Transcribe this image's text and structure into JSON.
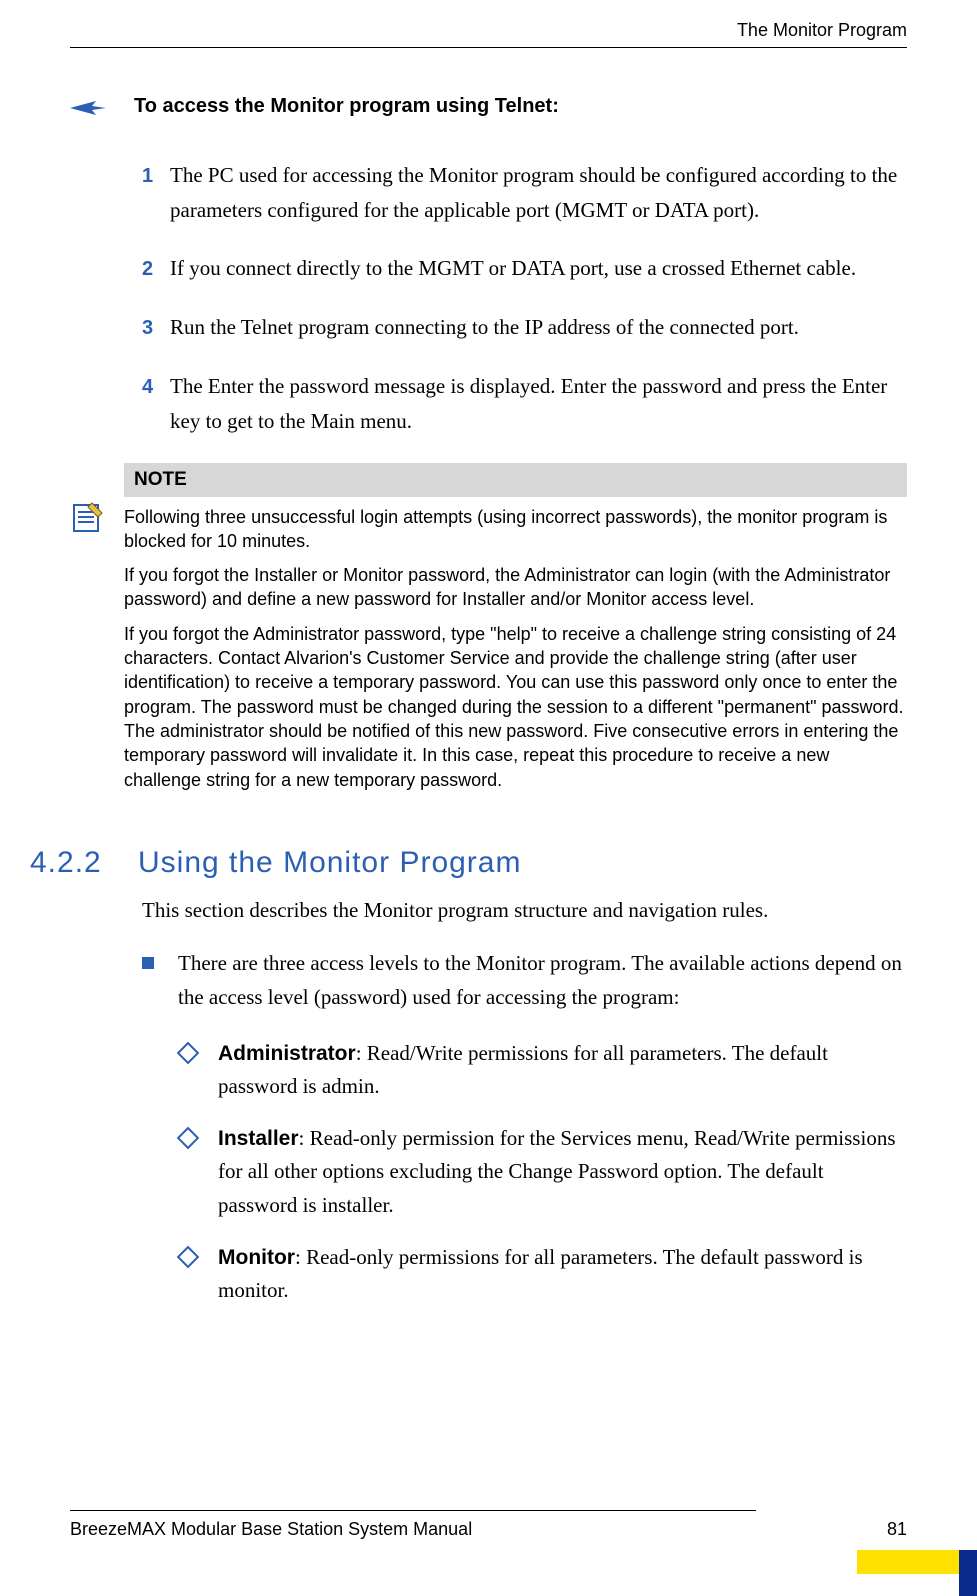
{
  "header": {
    "running_title": "The Monitor Program"
  },
  "intro": {
    "title": "To access the Monitor program using Telnet:"
  },
  "steps": [
    {
      "num": "1",
      "text": "The PC used for accessing the Monitor program should be configured according to the parameters configured for the applicable port (MGMT or DATA port)."
    },
    {
      "num": "2",
      "text": "If you connect directly to the MGMT or DATA port, use a crossed Ethernet cable."
    },
    {
      "num": "3",
      "text": "Run the Telnet program connecting to the IP address of the connected port."
    },
    {
      "num": "4",
      "text": "The Enter the password message  is displayed. Enter the password and press the Enter key to get to the Main menu."
    }
  ],
  "note": {
    "heading": "NOTE",
    "paras": [
      "Following three unsuccessful login attempts (using incorrect passwords), the monitor program is blocked for 10 minutes.",
      "If you forgot the Installer or Monitor password, the Administrator can login (with the Administrator password) and define a new password for Installer and/or Monitor access level.",
      "If you forgot the Administrator password, type \"help\" to receive a challenge string consisting of 24 characters. Contact Alvarion's Customer Service and provide the challenge string (after user identification) to receive a temporary password. You can use this password only once to enter the program. The password must be changed during the session to a different  \"permanent\" password. The administrator should be notified of this new password. Five consecutive errors in entering the temporary password will invalidate it. In this case, repeat this procedure to receive a new challenge string for a new temporary password."
    ]
  },
  "section": {
    "num": "4.2.2",
    "title": "Using the Monitor Program",
    "intro": "This section describes the Monitor program structure and navigation rules.",
    "bullet": "There are three access levels to the Monitor program. The available actions depend on the access level (password) used for accessing the program:",
    "subs": [
      {
        "lead": "Administrator",
        "rest": ": Read/Write permissions for all parameters. The default password is admin."
      },
      {
        "lead": "Installer",
        "rest": ": Read-only permission for the Services menu, Read/Write permissions for all other options excluding the Change Password option. The default password is installer."
      },
      {
        "lead": "Monitor",
        "rest": ": Read-only permissions for all parameters. The default password is monitor."
      }
    ]
  },
  "footer": {
    "manual": "BreezeMAX Modular Base Station System Manual",
    "page": "81"
  }
}
